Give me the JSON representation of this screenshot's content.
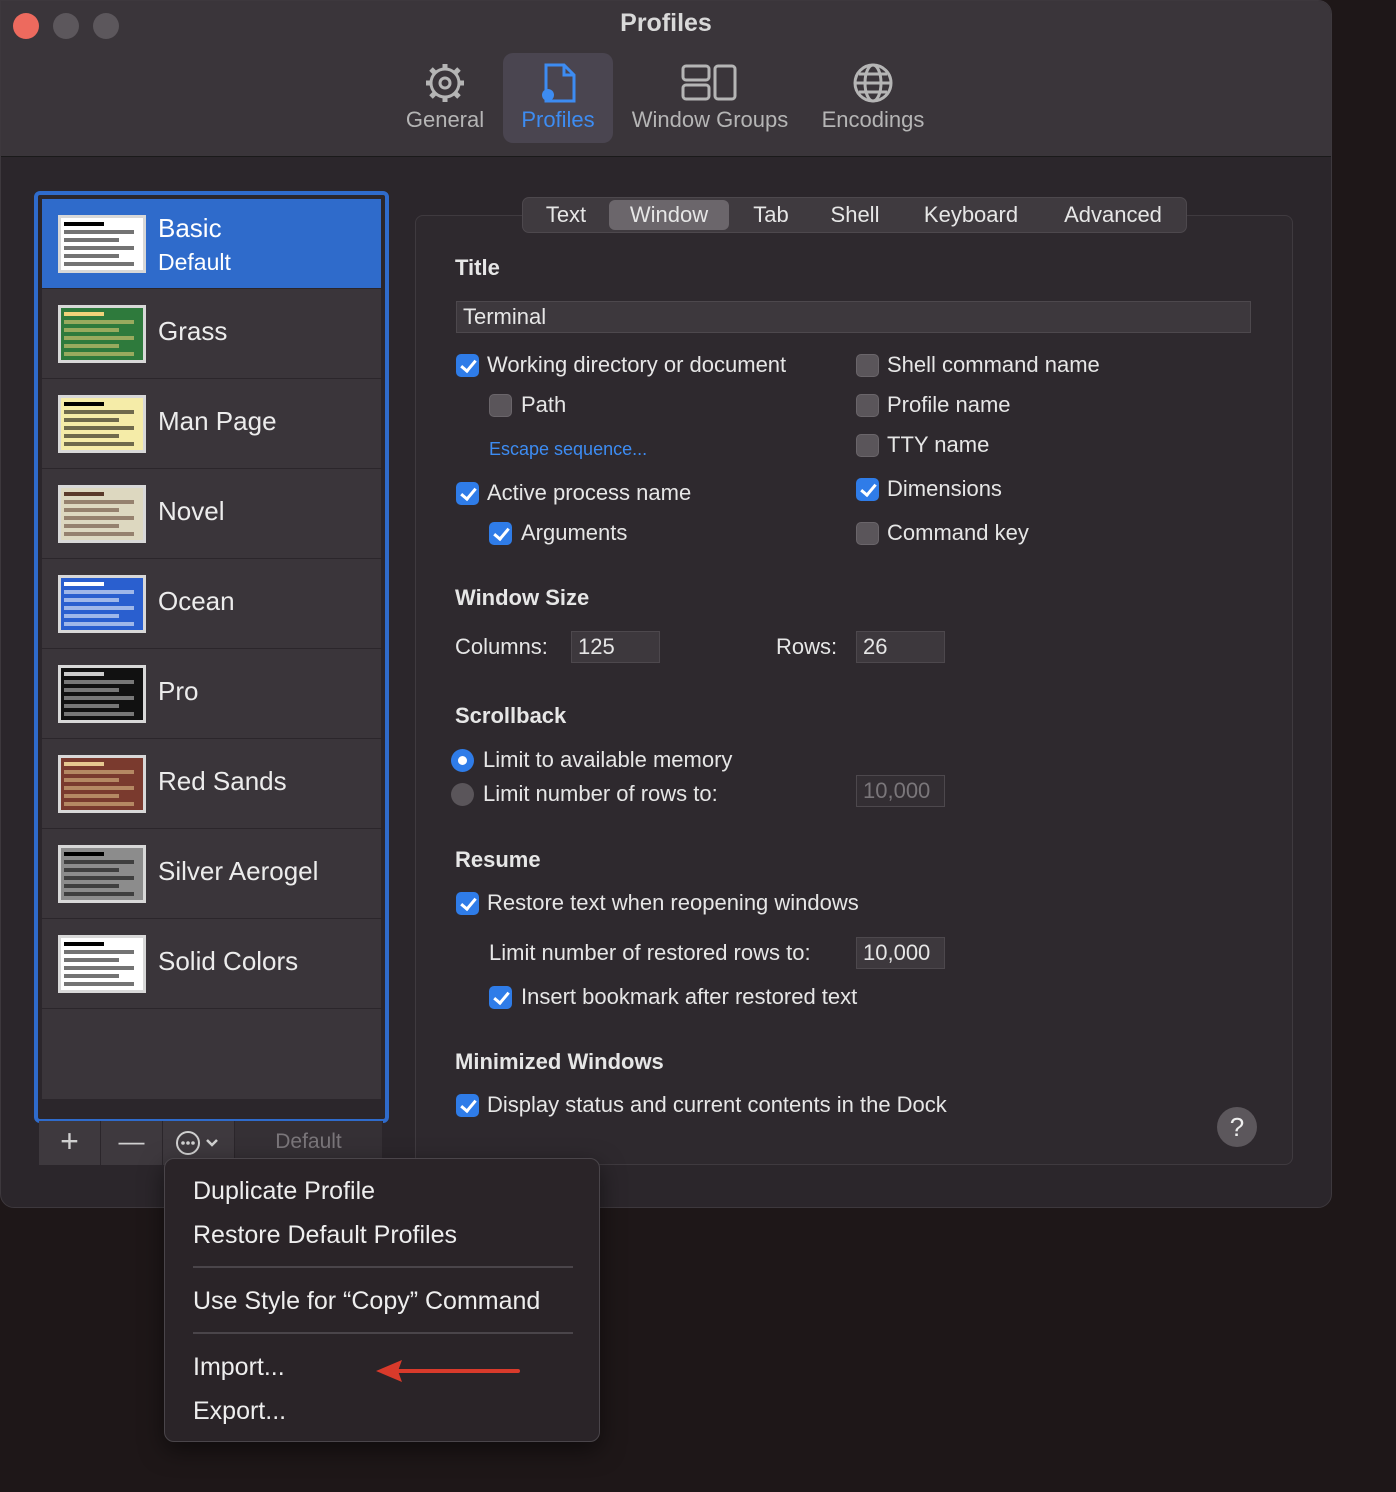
{
  "window": {
    "title": "Profiles"
  },
  "toolbar": {
    "items": [
      {
        "label": "General",
        "icon": "gear-icon"
      },
      {
        "label": "Profiles",
        "icon": "profile-document-icon"
      },
      {
        "label": "Window Groups",
        "icon": "window-groups-icon"
      },
      {
        "label": "Encodings",
        "icon": "globe-icon"
      }
    ],
    "active": "Profiles"
  },
  "profiles": [
    {
      "name": "Basic",
      "sub": "Default",
      "bg": "#ffffff",
      "fg": "#000000"
    },
    {
      "name": "Grass",
      "bg": "#2e7a3c",
      "fg": "#f0d27a"
    },
    {
      "name": "Man Page",
      "bg": "#f5eca8",
      "fg": "#000000"
    },
    {
      "name": "Novel",
      "bg": "#ddd8c0",
      "fg": "#5a3a2a"
    },
    {
      "name": "Ocean",
      "bg": "#2a5fcf",
      "fg": "#ffffff"
    },
    {
      "name": "Pro",
      "bg": "#111111",
      "fg": "#cccccc"
    },
    {
      "name": "Red Sands",
      "bg": "#7a3a2e",
      "fg": "#e6c890"
    },
    {
      "name": "Silver Aerogel",
      "bg": "#8c8c8c",
      "fg": "#000000"
    },
    {
      "name": "Solid Colors",
      "bg": "#ffffff",
      "fg": "#000000"
    }
  ],
  "sidebar_buttons": {
    "add": "+",
    "remove": "—",
    "default": "Default"
  },
  "tabs": [
    "Text",
    "Window",
    "Tab",
    "Shell",
    "Keyboard",
    "Advanced"
  ],
  "active_tab": "Window",
  "title_section": {
    "header": "Title",
    "value": "Terminal",
    "working_directory": "Working directory or document",
    "path": "Path",
    "escape_sequence": "Escape sequence...",
    "active_process": "Active process name",
    "arguments": "Arguments",
    "shell_command": "Shell command name",
    "profile_name": "Profile name",
    "tty_name": "TTY name",
    "dimensions": "Dimensions",
    "command_key": "Command key"
  },
  "window_size": {
    "header": "Window Size",
    "columns_label": "Columns:",
    "columns": "125",
    "rows_label": "Rows:",
    "rows": "26"
  },
  "scrollback": {
    "header": "Scrollback",
    "limit_memory": "Limit to available memory",
    "limit_rows": "Limit number of rows to:",
    "rows_value": "10,000"
  },
  "resume": {
    "header": "Resume",
    "restore_text": "Restore text when reopening windows",
    "limit_restored": "Limit number of restored rows to:",
    "restored_value": "10,000",
    "insert_bookmark": "Insert bookmark after restored text"
  },
  "minimized": {
    "header": "Minimized Windows",
    "display_status": "Display status and current contents in the Dock"
  },
  "help": "?",
  "menu": {
    "duplicate": "Duplicate Profile",
    "restore": "Restore Default Profiles",
    "copy_style": "Use Style for “Copy” Command",
    "import": "Import...",
    "export": "Export..."
  },
  "colors": {
    "accent": "#2f7ce8",
    "selection": "#2f6bcb",
    "arrow": "#d93a2b"
  }
}
